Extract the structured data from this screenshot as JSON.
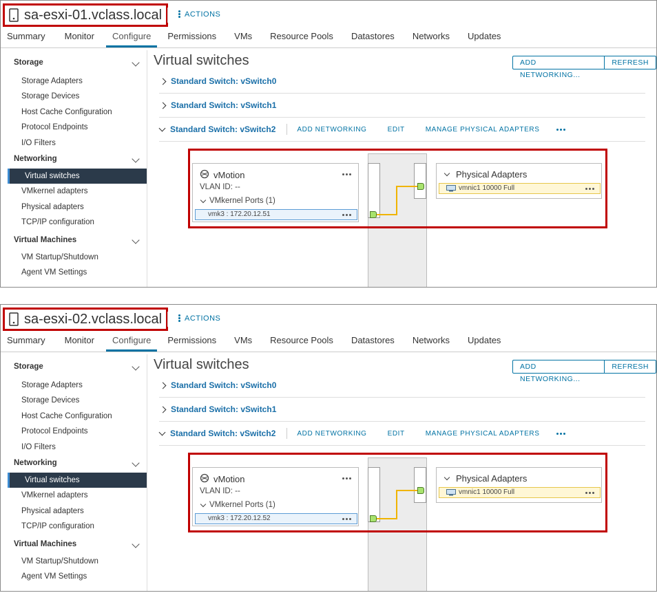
{
  "panels": [
    {
      "host_name": "sa-esxi-01.vclass.local",
      "actions_label": "ACTIONS",
      "tabs": [
        "Summary",
        "Monitor",
        "Configure",
        "Permissions",
        "VMs",
        "Resource Pools",
        "Datastores",
        "Networks",
        "Updates"
      ],
      "active_tab": "Configure",
      "sidebar": {
        "storage_label": "Storage",
        "storage_items": [
          "Storage Adapters",
          "Storage Devices",
          "Host Cache Configuration",
          "Protocol Endpoints",
          "I/O Filters"
        ],
        "networking_label": "Networking",
        "networking_items": [
          "Virtual switches",
          "VMkernel adapters",
          "Physical adapters",
          "TCP/IP configuration"
        ],
        "vm_label": "Virtual Machines",
        "vm_items": [
          "VM Startup/Shutdown",
          "Agent VM Settings"
        ]
      },
      "main": {
        "title": "Virtual switches",
        "add_networking_btn": "ADD NETWORKING...",
        "refresh_btn": "REFRESH",
        "switches": [
          "Standard Switch: vSwitch0",
          "Standard Switch: vSwitch1",
          "Standard Switch: vSwitch2"
        ],
        "switch_actions": [
          "ADD NETWORKING",
          "EDIT",
          "MANAGE PHYSICAL ADAPTERS"
        ],
        "port_group": {
          "name": "vMotion",
          "vlan": "VLAN ID: --",
          "ports_label": "VMkernel Ports (1)",
          "port": "vmk3 : 172.20.12.51"
        },
        "physical_adapters": {
          "label": "Physical Adapters",
          "adapter": "vmnic1 10000 Full"
        }
      }
    },
    {
      "host_name": "sa-esxi-02.vclass.local",
      "actions_label": "ACTIONS",
      "tabs": [
        "Summary",
        "Monitor",
        "Configure",
        "Permissions",
        "VMs",
        "Resource Pools",
        "Datastores",
        "Networks",
        "Updates"
      ],
      "active_tab": "Configure",
      "sidebar": {
        "storage_label": "Storage",
        "storage_items": [
          "Storage Adapters",
          "Storage Devices",
          "Host Cache Configuration",
          "Protocol Endpoints",
          "I/O Filters"
        ],
        "networking_label": "Networking",
        "networking_items": [
          "Virtual switches",
          "VMkernel adapters",
          "Physical adapters",
          "TCP/IP configuration"
        ],
        "vm_label": "Virtual Machines",
        "vm_items": [
          "VM Startup/Shutdown",
          "Agent VM Settings"
        ]
      },
      "main": {
        "title": "Virtual switches",
        "add_networking_btn": "ADD NETWORKING...",
        "refresh_btn": "REFRESH",
        "switches": [
          "Standard Switch: vSwitch0",
          "Standard Switch: vSwitch1",
          "Standard Switch: vSwitch2"
        ],
        "switch_actions": [
          "ADD NETWORKING",
          "EDIT",
          "MANAGE PHYSICAL ADAPTERS"
        ],
        "port_group": {
          "name": "vMotion",
          "vlan": "VLAN ID: --",
          "ports_label": "VMkernel Ports (1)",
          "port": "vmk3 : 172.20.12.52"
        },
        "physical_adapters": {
          "label": "Physical Adapters",
          "adapter": "vmnic1 10000 Full"
        }
      }
    }
  ],
  "icons": {
    "host": "server-icon",
    "actions": "kebab-vertical-icon",
    "port_group": "network-globe-icon",
    "adapter": "nic-icon",
    "more": "kebab-horizontal-icon"
  },
  "colors": {
    "accent": "#0072a3",
    "highlight_border": "#c00000",
    "active_nav_bg": "#2b3a4a",
    "port_green": "#a8e36d",
    "link_yellow": "#f0b400"
  }
}
